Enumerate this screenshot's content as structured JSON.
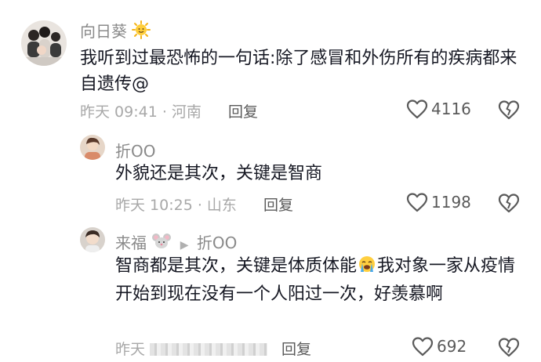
{
  "comments": [
    {
      "username": "向日葵",
      "username_emoji": "sun-icon",
      "text": "我听到过最恐怖的一句话:除了感冒和外伤所有的疾病都来自遗传@",
      "meta": "昨天 09:41 · 河南",
      "reply_label": "回复",
      "likes": "4116"
    },
    {
      "username": "折OO",
      "text": "外貌还是其次，关键是智商",
      "meta": "昨天 10:25 · 山东",
      "reply_label": "回复",
      "likes": "1198"
    },
    {
      "username": "来福",
      "username_emoji": "mouse-icon",
      "reply_to": "折OO",
      "text_part1": "智商都是其次，关键是体质体能",
      "text_emoji": "crying-face-icon",
      "text_part2": "我对象一家从疫情开始到现在没有一个人阳过一次，好羡慕啊",
      "meta": "昨天",
      "reply_label": "回复",
      "likes": "692"
    }
  ]
}
